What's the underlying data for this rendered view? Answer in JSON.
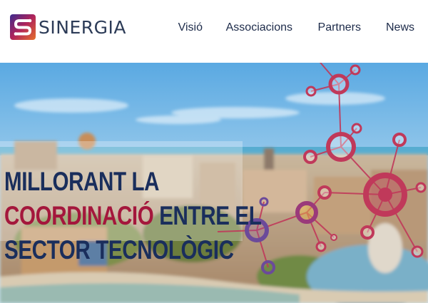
{
  "brand": {
    "name": "SINERGIA",
    "mark_letter": "S"
  },
  "nav": {
    "items": [
      "Visió",
      "Associacions",
      "Partners",
      "News"
    ]
  },
  "hero": {
    "line1": "MILLORANT LA",
    "line2_accent": "COORDINACIÓ",
    "line2_rest": " ENTRE EL",
    "line3": "SECTOR TECNOLÒGIC"
  },
  "colors": {
    "navy": "#1a2e5c",
    "crimson": "#a4173c",
    "network": "#c0395a"
  }
}
